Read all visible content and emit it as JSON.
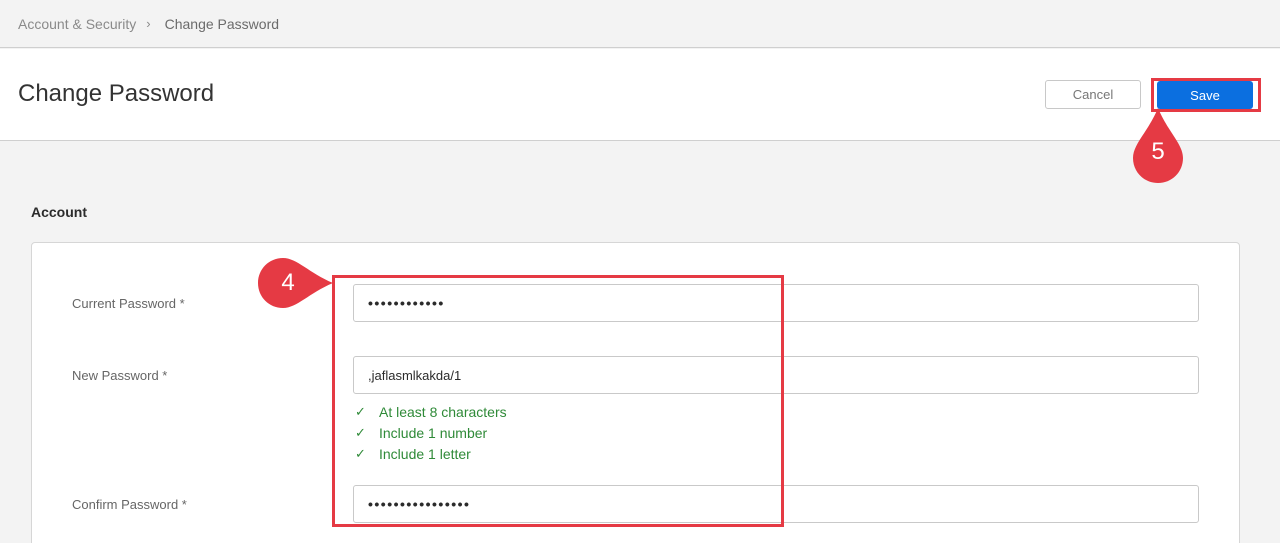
{
  "breadcrumb": {
    "parent": "Account & Security",
    "separator": "›",
    "current": "Change Password"
  },
  "header": {
    "title": "Change Password",
    "cancel_label": "Cancel",
    "save_label": "Save"
  },
  "section": {
    "title": "Account"
  },
  "form": {
    "current_password": {
      "label": "Current Password *",
      "value": "••••••••••••"
    },
    "new_password": {
      "label": "New Password *",
      "value": ",jaflasmlkakda/1"
    },
    "rules": [
      {
        "icon": "checkmark-icon",
        "glyph": "✓",
        "text": "At least 8 characters"
      },
      {
        "icon": "checkmark-icon",
        "glyph": "✓",
        "text": "Include 1 number"
      },
      {
        "icon": "checkmark-icon",
        "glyph": "✓",
        "text": "Include 1 letter"
      }
    ],
    "confirm_password": {
      "label": "Confirm Password *",
      "value": "••••••••••••••••"
    }
  },
  "annotations": {
    "step_fields": "4",
    "step_save": "5"
  },
  "colors": {
    "accent": "#0b6fe0",
    "annotation": "#e53a44",
    "success": "#2f8a38"
  }
}
